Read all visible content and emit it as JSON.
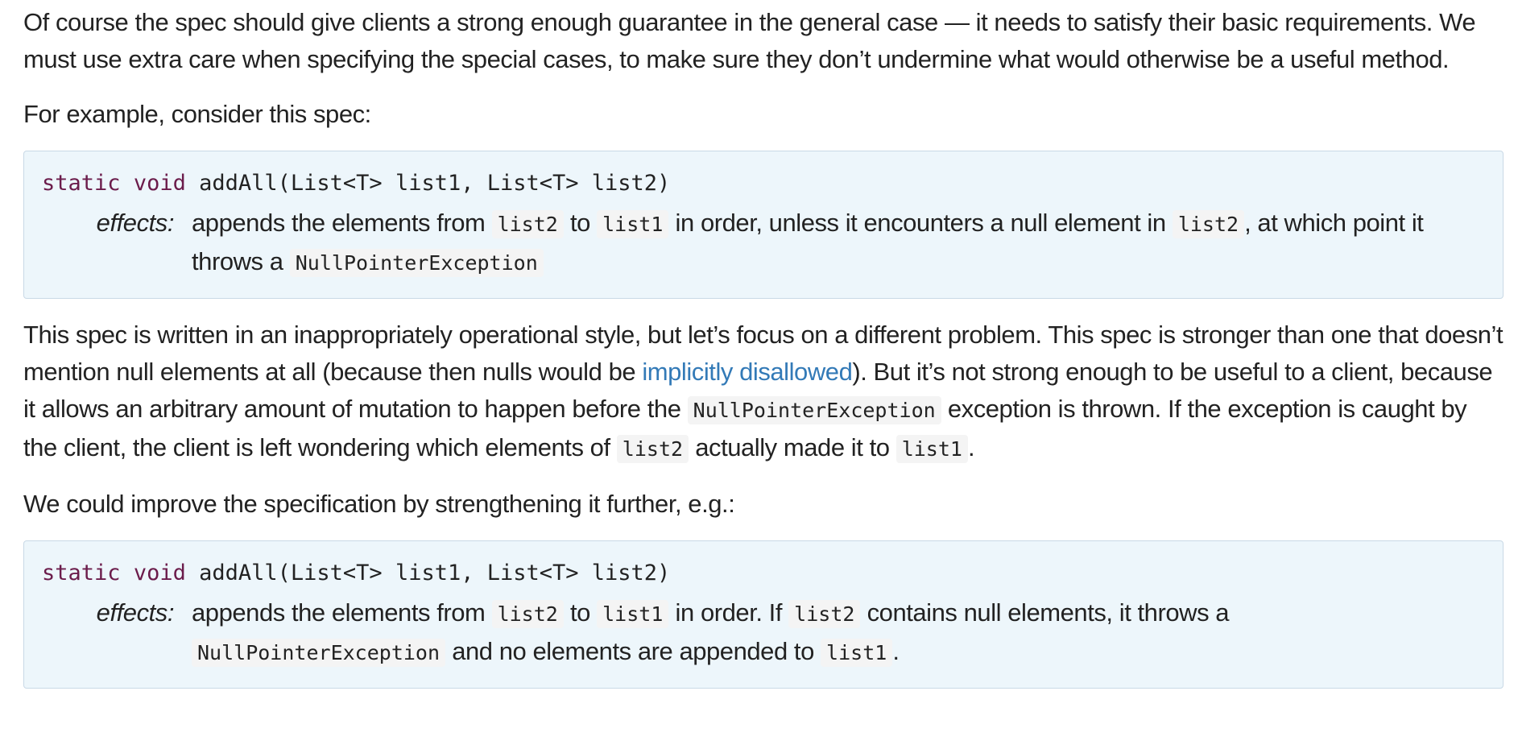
{
  "paragraphs": {
    "p1": "Of course the spec should give clients a strong enough guarantee in the general case — it needs to satisfy their basic requirements. We must use extra care when specifying the special cases, to make sure they don’t undermine what would otherwise be a useful method.",
    "p2": "For example, consider this spec:",
    "p3": {
      "t1": "This spec is written in an inappropriately operational style, but let’s focus on a different problem. This spec is stronger than one that doesn’t mention null elements at all (because then nulls would be ",
      "link": "implicitly disallowed",
      "t2": "). But it’s not strong enough to be useful to a client, because it allows an arbitrary amount of mutation to happen before the ",
      "code1": "NullPointerException",
      "t3": " exception is thrown. If the exception is caught by the client, the client is left wondering which elements of ",
      "code2": "list2",
      "t4": " actually made it to ",
      "code3": "list1",
      "t5": "."
    },
    "p4": "We could improve the specification by strengthening it further, e.g.:"
  },
  "spec1": {
    "kw_static": "static",
    "kw_void": "void",
    "sig_rest": "addAll(List<T> list1, List<T> list2)",
    "effects_label": "effects:",
    "e1": "appends the elements from ",
    "c1": "list2",
    "e2": " to ",
    "c2": "list1",
    "e3": " in order, unless it encounters a null element in ",
    "c3": "list2",
    "e4": ", at which point it throws a ",
    "c4": "NullPointerException"
  },
  "spec2": {
    "kw_static": "static",
    "kw_void": "void",
    "sig_rest": "addAll(List<T> list1, List<T> list2)",
    "effects_label": "effects:",
    "e1": "appends the elements from ",
    "c1": "list2",
    "e2": " to ",
    "c2": "list1",
    "e3": " in order. If ",
    "c3": "list2",
    "e4": " contains null elements, it throws a ",
    "c4": "NullPointerException",
    "e5": " and no elements are appended to ",
    "c5": "list1",
    "e6": "."
  },
  "colors": {
    "link": "#337ab7",
    "keyword": "#6b1c4b",
    "spec_bg": "#edf6fb",
    "spec_border": "#c9d9e6",
    "inline_code_bg": "#f4f4f4"
  }
}
